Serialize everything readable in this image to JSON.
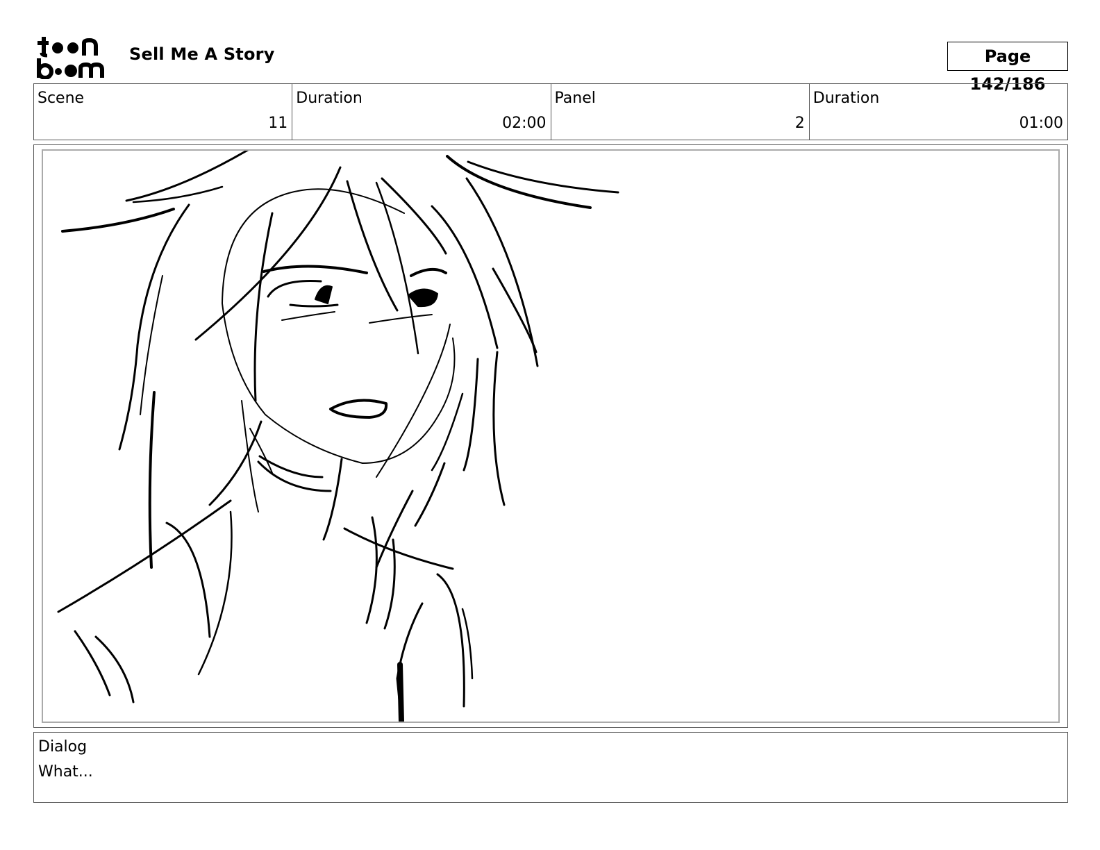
{
  "header": {
    "logo_alt": "toon boom",
    "title": "Sell Me A Story",
    "page": "Page 142/186"
  },
  "info": {
    "scene_label": "Scene",
    "scene_value": "11",
    "scene_duration_label": "Duration",
    "scene_duration_value": "02:00",
    "panel_label": "Panel",
    "panel_value": "2",
    "panel_duration_label": "Duration",
    "panel_duration_value": "01:00"
  },
  "dialog": {
    "label": "Dialog",
    "text": "What..."
  }
}
